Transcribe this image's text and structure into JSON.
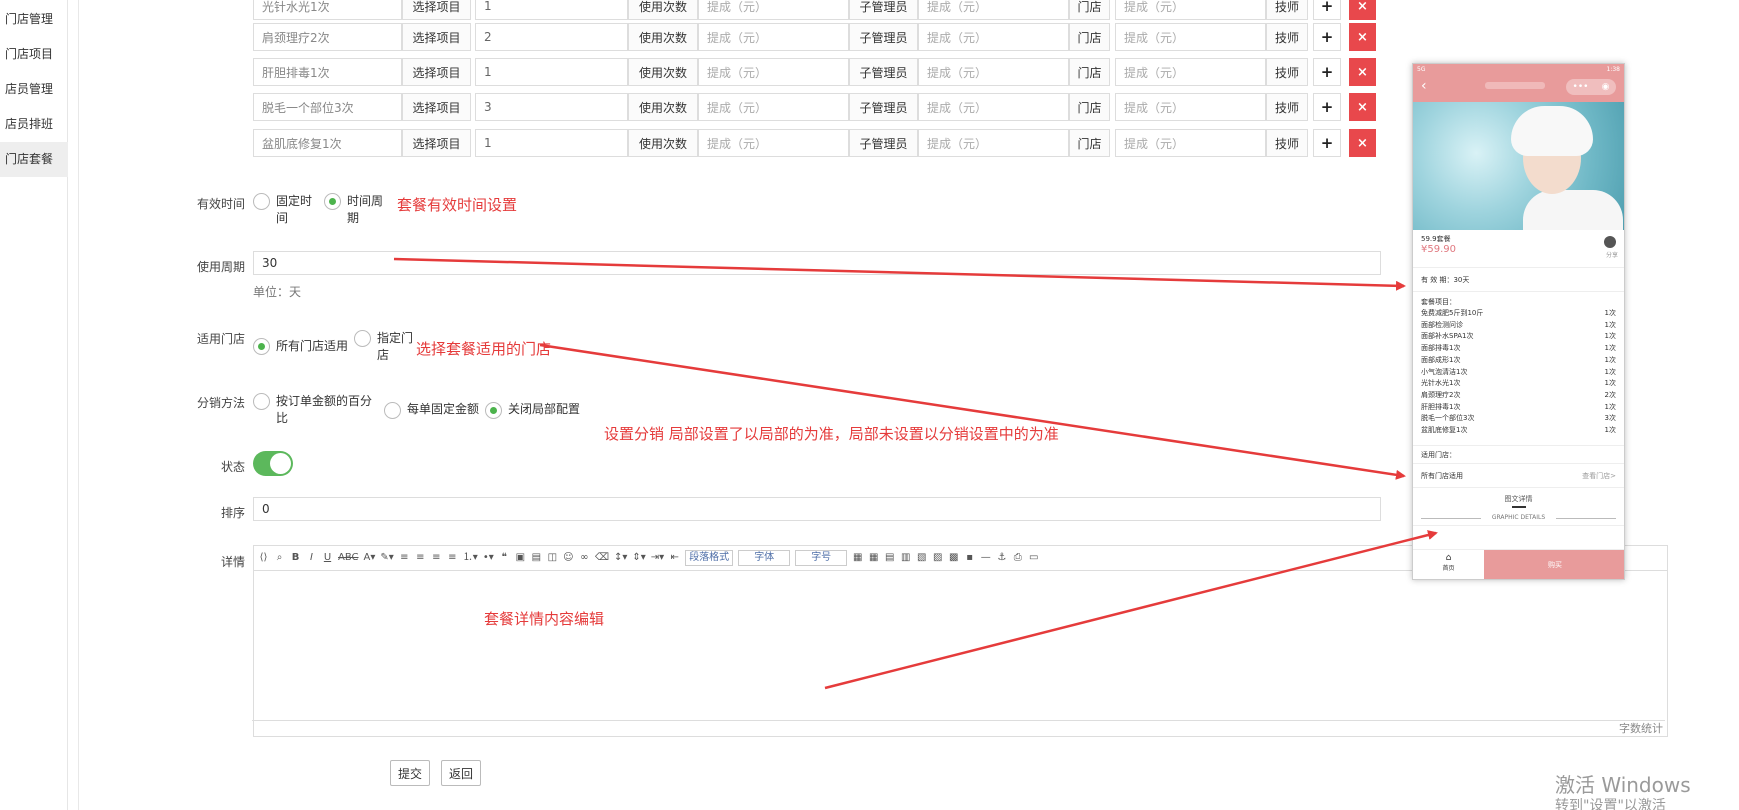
{
  "sidebar": {
    "items": [
      {
        "label": "门店管理"
      },
      {
        "label": "门店项目"
      },
      {
        "label": "店员管理"
      },
      {
        "label": "店员排班"
      },
      {
        "label": "门店套餐"
      }
    ],
    "active_index": 4
  },
  "item_rows": [
    {
      "name": "光针水光1次",
      "select": "选择项目",
      "count": "1",
      "count_label": "使用次数",
      "commission1": "提成（元）",
      "sub_admin": "子管理员",
      "commission2": "提成（元）",
      "store": "门店",
      "commission3": "提成（元）",
      "tech": "技师",
      "add": "+",
      "del": "×"
    },
    {
      "name": "肩颈理疗2次",
      "select": "选择项目",
      "count": "2",
      "count_label": "使用次数",
      "commission1": "提成（元）",
      "sub_admin": "子管理员",
      "commission2": "提成（元）",
      "store": "门店",
      "commission3": "提成（元）",
      "tech": "技师",
      "add": "+",
      "del": "×"
    },
    {
      "name": "肝胆排毒1次",
      "select": "选择项目",
      "count": "1",
      "count_label": "使用次数",
      "commission1": "提成（元）",
      "sub_admin": "子管理员",
      "commission2": "提成（元）",
      "store": "门店",
      "commission3": "提成（元）",
      "tech": "技师",
      "add": "+",
      "del": "×"
    },
    {
      "name": "脱毛一个部位3次",
      "select": "选择项目",
      "count": "3",
      "count_label": "使用次数",
      "commission1": "提成（元）",
      "sub_admin": "子管理员",
      "commission2": "提成（元）",
      "store": "门店",
      "commission3": "提成（元）",
      "tech": "技师",
      "add": "+",
      "del": "×"
    },
    {
      "name": "盆肌底修复1次",
      "select": "选择项目",
      "count": "1",
      "count_label": "使用次数",
      "commission1": "提成（元）",
      "sub_admin": "子管理员",
      "commission2": "提成（元）",
      "store": "门店",
      "commission3": "提成（元）",
      "tech": "技师",
      "add": "+",
      "del": "×"
    }
  ],
  "form": {
    "validity": {
      "label": "有效时间",
      "option_fixed": "固定时间",
      "option_period": "时间周期",
      "selected": "option_period"
    },
    "period": {
      "label": "使用周期",
      "value": "30",
      "unit": "单位：天"
    },
    "stores": {
      "label": "适用门店",
      "option_all": "所有门店适用",
      "option_some": "指定门店",
      "selected": "option_all"
    },
    "distribution": {
      "label": "分销方法",
      "option_percent": "按订单金额的百分比",
      "option_fixed": "每单固定金额",
      "option_off": "关闭局部配置",
      "selected": "option_off"
    },
    "status": {
      "label": "状态",
      "on": true
    },
    "sort": {
      "label": "排序",
      "value": "0"
    },
    "detail": {
      "label": "详情"
    }
  },
  "editor": {
    "paragraph_select": "段落格式",
    "font_select": "字体",
    "size_select": "字号",
    "word_count": "字数统计"
  },
  "buttons": {
    "submit": "提交",
    "back": "返回"
  },
  "annotations": {
    "validity": "套餐有效时间设置",
    "stores": "选择套餐适用的门店",
    "distribution": "设置分销  局部设置了以局部的为准，局部未设置以分销设置中的为准",
    "detail": "套餐详情内容编辑"
  },
  "phone": {
    "package_name": "59.9套餐",
    "price": "¥59.90",
    "share": "分享",
    "validity_text": "有 效 期：30天",
    "items_title": "套餐项目：",
    "items": [
      {
        "name": "免费减肥5斤到10斤",
        "count": "1次"
      },
      {
        "name": "面部检测问诊",
        "count": "1次"
      },
      {
        "name": "面部补水SPA1次",
        "count": "1次"
      },
      {
        "name": "面部排毒1次",
        "count": "1次"
      },
      {
        "name": "面部成形1次",
        "count": "1次"
      },
      {
        "name": "小气泡清洁1次",
        "count": "1次"
      },
      {
        "name": "光针水光1次",
        "count": "1次"
      },
      {
        "name": "肩颈理疗2次",
        "count": "2次"
      },
      {
        "name": "肝胆排毒1次",
        "count": "1次"
      },
      {
        "name": "脱毛一个部位3次",
        "count": "3次"
      },
      {
        "name": "盆肌底修复1次",
        "count": "1次"
      }
    ],
    "stores_title": "适用门店：",
    "stores_value": "所有门店适用",
    "stores_link": "查看门店>",
    "tab_detail": "图文详情",
    "graphic_details": "GRAPHIC DETAILS",
    "home": "首页",
    "buy": "购买",
    "status_left": "5G",
    "status_right": "1:38"
  },
  "watermark": {
    "line1": "激活 Windows",
    "line2": "转到\"设置\"以激活 Windows。"
  },
  "colors": {
    "accent_red": "#e53b3b",
    "green": "#5cb85c",
    "pink": "#e89b9b",
    "delete_red": "#e8484c"
  }
}
